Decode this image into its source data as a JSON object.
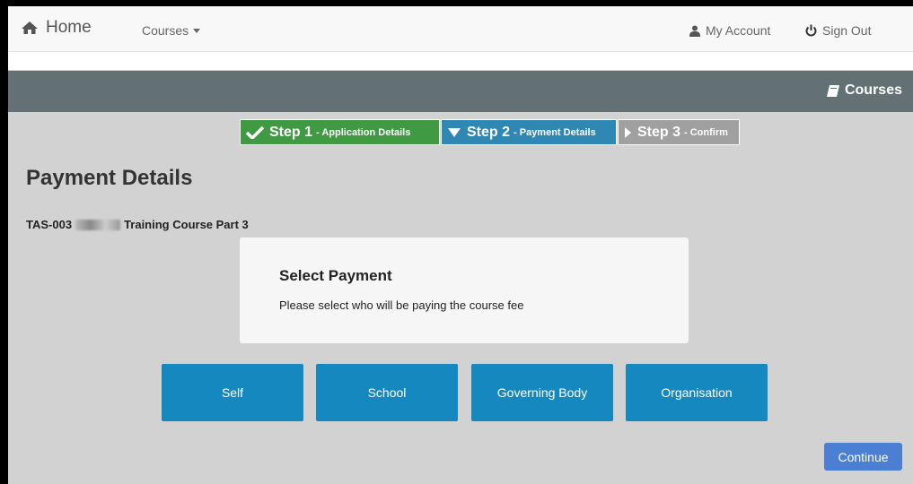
{
  "nav": {
    "home_label": "Home",
    "courses_label": "Courses",
    "account_label": "My Account",
    "signout_label": "Sign Out"
  },
  "banner": {
    "title": "Courses"
  },
  "steps": [
    {
      "label": "Step 1",
      "detail": "- Application Details",
      "state": "complete",
      "color": "#3f9a43"
    },
    {
      "label": "Step 2",
      "detail": "- Payment Details",
      "state": "current",
      "color": "#2f87b3"
    },
    {
      "label": "Step 3",
      "detail": "- Confirm",
      "state": "upcoming",
      "color": "#a0a0a0"
    }
  ],
  "page": {
    "title": "Payment Details",
    "course_code": "TAS-003",
    "course_name": "Training Course Part 3"
  },
  "card": {
    "title": "Select Payment",
    "text": "Please select who will be paying the course fee"
  },
  "payment_options": [
    "Self",
    "School",
    "Governing Body",
    "Organisation"
  ],
  "continue_label": "Continue",
  "colors": {
    "accent": "#1488bf",
    "banner": "#637174",
    "continue": "#4a7fd4"
  }
}
